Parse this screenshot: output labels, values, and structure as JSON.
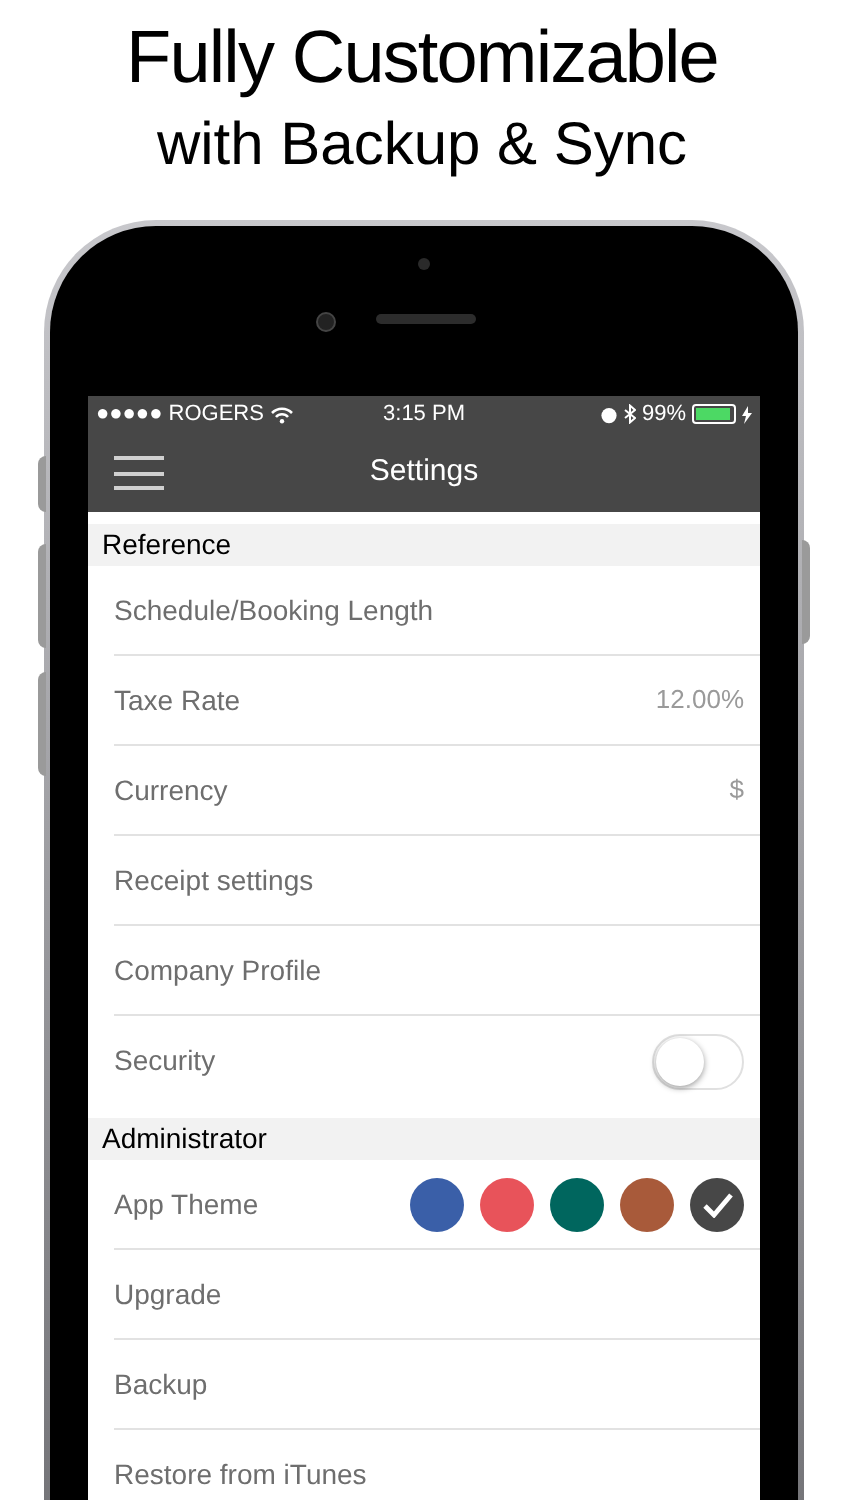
{
  "headline": [
    "Fully Customizable",
    "with Backup & Sync"
  ],
  "status_bar": {
    "carrier": "●●●●● ROGERS",
    "time": "3:15 PM",
    "battery": "99%"
  },
  "nav": {
    "title": "Settings"
  },
  "sections": [
    {
      "title": "Reference",
      "rows": [
        {
          "kind": "plain",
          "label": "Schedule/Booking Length"
        },
        {
          "kind": "value",
          "label": "Taxe Rate",
          "value": "12.00%"
        },
        {
          "kind": "value",
          "label": "Currency",
          "value": "$"
        },
        {
          "kind": "plain",
          "label": "Receipt settings"
        },
        {
          "kind": "plain",
          "label": "Company Profile"
        },
        {
          "kind": "toggle",
          "label": "Security",
          "on": false
        }
      ]
    },
    {
      "title": "Administrator",
      "rows": [
        {
          "kind": "theme",
          "label": "App Theme",
          "swatches": [
            {
              "color": "#3a5fa8",
              "selected": false
            },
            {
              "color": "#e8535a",
              "selected": false
            },
            {
              "color": "#00665e",
              "selected": false
            },
            {
              "color": "#a85a3a",
              "selected": false
            },
            {
              "color": "#474747",
              "selected": true
            }
          ]
        },
        {
          "kind": "plain",
          "label": "Upgrade"
        },
        {
          "kind": "plain",
          "label": "Backup"
        },
        {
          "kind": "plain",
          "label": "Restore from iTunes"
        }
      ]
    }
  ]
}
